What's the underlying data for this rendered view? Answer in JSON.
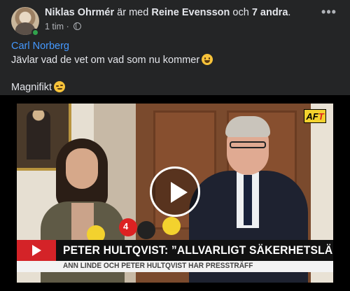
{
  "post": {
    "author": "Niklas Ohrmér",
    "with_text": "är med",
    "tagged_person": "Reine Evensson",
    "and_text": "och",
    "others": "7 andra",
    "trailing": ".",
    "time": "1 tim",
    "time_separator": "·",
    "privacy_icon": "globe-icon",
    "more_icon": "more-options-icon",
    "more_label": "•••",
    "mention": "Carl Norberg",
    "text_line_1": "Jävlar vad de vet om vad som nu kommer",
    "text_line_2": "Magnifikt"
  },
  "video": {
    "logo_text": "AF",
    "logo_accent": "T",
    "mic_label": "4",
    "headline": "PETER HULTQVIST: ”ALLVARLIGT SÄKERHETSLÄGE”",
    "subheadline": "ANN LINDE OCH PETER HULTQVIST HAR PRESSTRÄFF",
    "play_icon": "play-icon"
  },
  "colors": {
    "background": "#242526",
    "mention": "#4599ff",
    "online": "#31a24c",
    "ticker_red": "#d42328"
  }
}
